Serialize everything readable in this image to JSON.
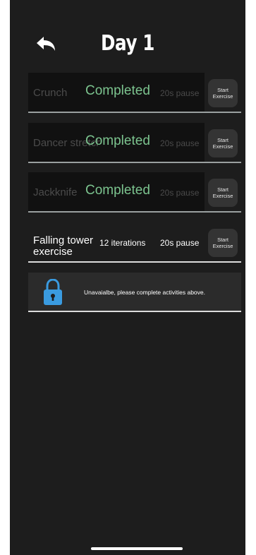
{
  "header": {
    "title": "Day 1"
  },
  "icons": {
    "back": "undo-arrow-icon",
    "lock": "lock-icon"
  },
  "colors": {
    "completed": "#7cc48f",
    "lock": "#3a9be0",
    "background": "#1d1d1d"
  },
  "exercises": [
    {
      "name": "Crunch",
      "status": "Completed",
      "pause": "20s pause",
      "start_label_1": "Start",
      "start_label_2": "Exercise"
    },
    {
      "name": "Dancer stretch",
      "status": "Completed",
      "pause": "20s pause",
      "start_label_1": "Start",
      "start_label_2": "Exercise"
    },
    {
      "name": "Jackknife",
      "status": "Completed",
      "pause": "20s pause",
      "start_label_1": "Start",
      "start_label_2": "Exercise"
    },
    {
      "name": "Falling tower exercise",
      "iterations": "12 iterations",
      "pause": "20s pause",
      "start_label_1": "Start",
      "start_label_2": "Exercise"
    }
  ],
  "locked": {
    "message": "Unavaialbe, please complete activities above."
  }
}
